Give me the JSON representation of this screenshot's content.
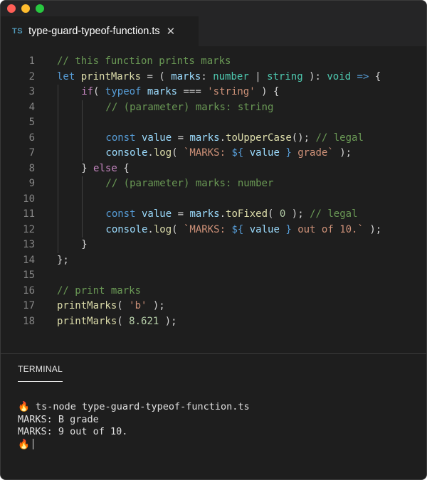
{
  "window": {
    "controls": [
      "close",
      "minimize",
      "maximize"
    ]
  },
  "tab": {
    "badge": "TS",
    "label": "type-guard-typeof-function.ts",
    "close": "✕"
  },
  "editor": {
    "lines": [
      {
        "num": "1",
        "indent": 0,
        "tokens": [
          [
            "c",
            "// this function prints marks"
          ]
        ]
      },
      {
        "num": "2",
        "indent": 0,
        "tokens": [
          [
            "k",
            "let"
          ],
          [
            "p",
            " "
          ],
          [
            "f",
            "printMarks"
          ],
          [
            "p",
            " = ( "
          ],
          [
            "v",
            "marks"
          ],
          [
            "p",
            ": "
          ],
          [
            "t",
            "number"
          ],
          [
            "p",
            " | "
          ],
          [
            "t",
            "string"
          ],
          [
            "p",
            " ): "
          ],
          [
            "t",
            "void"
          ],
          [
            "p",
            " "
          ],
          [
            "k",
            "=>"
          ],
          [
            "p",
            " {"
          ]
        ]
      },
      {
        "num": "3",
        "indent": 1,
        "tokens": [
          [
            "ctrl",
            "if"
          ],
          [
            "p",
            "( "
          ],
          [
            "k",
            "typeof"
          ],
          [
            "p",
            " "
          ],
          [
            "v",
            "marks"
          ],
          [
            "p",
            " === "
          ],
          [
            "s",
            "'string'"
          ],
          [
            "p",
            " ) {"
          ]
        ]
      },
      {
        "num": "4",
        "indent": 2,
        "tokens": [
          [
            "c",
            "// (parameter) marks: string"
          ]
        ]
      },
      {
        "num": "5",
        "indent": 2,
        "tokens": []
      },
      {
        "num": "6",
        "indent": 2,
        "tokens": [
          [
            "k",
            "const"
          ],
          [
            "p",
            " "
          ],
          [
            "v",
            "value"
          ],
          [
            "p",
            " = "
          ],
          [
            "v",
            "marks"
          ],
          [
            "p",
            "."
          ],
          [
            "f",
            "toUpperCase"
          ],
          [
            "p",
            "(); "
          ],
          [
            "c",
            "// legal"
          ]
        ]
      },
      {
        "num": "7",
        "indent": 2,
        "tokens": [
          [
            "v",
            "console"
          ],
          [
            "p",
            "."
          ],
          [
            "f",
            "log"
          ],
          [
            "p",
            "( "
          ],
          [
            "s",
            "`MARKS: "
          ],
          [
            "k",
            "${"
          ],
          [
            "p",
            " "
          ],
          [
            "v",
            "value"
          ],
          [
            "p",
            " "
          ],
          [
            "k",
            "}"
          ],
          [
            "s",
            " grade`"
          ],
          [
            "p",
            " );"
          ]
        ]
      },
      {
        "num": "8",
        "indent": 1,
        "tokens": [
          [
            "p",
            "} "
          ],
          [
            "ctrl",
            "else"
          ],
          [
            "p",
            " {"
          ]
        ]
      },
      {
        "num": "9",
        "indent": 2,
        "tokens": [
          [
            "c",
            "// (parameter) marks: number"
          ]
        ]
      },
      {
        "num": "10",
        "indent": 2,
        "tokens": []
      },
      {
        "num": "11",
        "indent": 2,
        "tokens": [
          [
            "k",
            "const"
          ],
          [
            "p",
            " "
          ],
          [
            "v",
            "value"
          ],
          [
            "p",
            " = "
          ],
          [
            "v",
            "marks"
          ],
          [
            "p",
            "."
          ],
          [
            "f",
            "toFixed"
          ],
          [
            "p",
            "( "
          ],
          [
            "n",
            "0"
          ],
          [
            "p",
            " ); "
          ],
          [
            "c",
            "// legal"
          ]
        ]
      },
      {
        "num": "12",
        "indent": 2,
        "tokens": [
          [
            "v",
            "console"
          ],
          [
            "p",
            "."
          ],
          [
            "f",
            "log"
          ],
          [
            "p",
            "( "
          ],
          [
            "s",
            "`MARKS: "
          ],
          [
            "k",
            "${"
          ],
          [
            "p",
            " "
          ],
          [
            "v",
            "value"
          ],
          [
            "p",
            " "
          ],
          [
            "k",
            "}"
          ],
          [
            "s",
            " out of 10.`"
          ],
          [
            "p",
            " );"
          ]
        ]
      },
      {
        "num": "13",
        "indent": 1,
        "tokens": [
          [
            "p",
            "}"
          ]
        ]
      },
      {
        "num": "14",
        "indent": 0,
        "tokens": [
          [
            "p",
            "};"
          ]
        ]
      },
      {
        "num": "15",
        "indent": 0,
        "tokens": []
      },
      {
        "num": "16",
        "indent": 0,
        "tokens": [
          [
            "c",
            "// print marks"
          ]
        ]
      },
      {
        "num": "17",
        "indent": 0,
        "tokens": [
          [
            "f",
            "printMarks"
          ],
          [
            "p",
            "( "
          ],
          [
            "s",
            "'b'"
          ],
          [
            "p",
            " );"
          ]
        ]
      },
      {
        "num": "18",
        "indent": 0,
        "tokens": [
          [
            "f",
            "printMarks"
          ],
          [
            "p",
            "( "
          ],
          [
            "n",
            "8.621"
          ],
          [
            "p",
            " );"
          ]
        ]
      }
    ]
  },
  "panel": {
    "tab_label": "TERMINAL"
  },
  "terminal": {
    "lines": [
      "🔥 ts-node type-guard-typeof-function.ts",
      "MARKS: B grade",
      "MARKS: 9 out of 10."
    ],
    "prompt": "🔥"
  }
}
